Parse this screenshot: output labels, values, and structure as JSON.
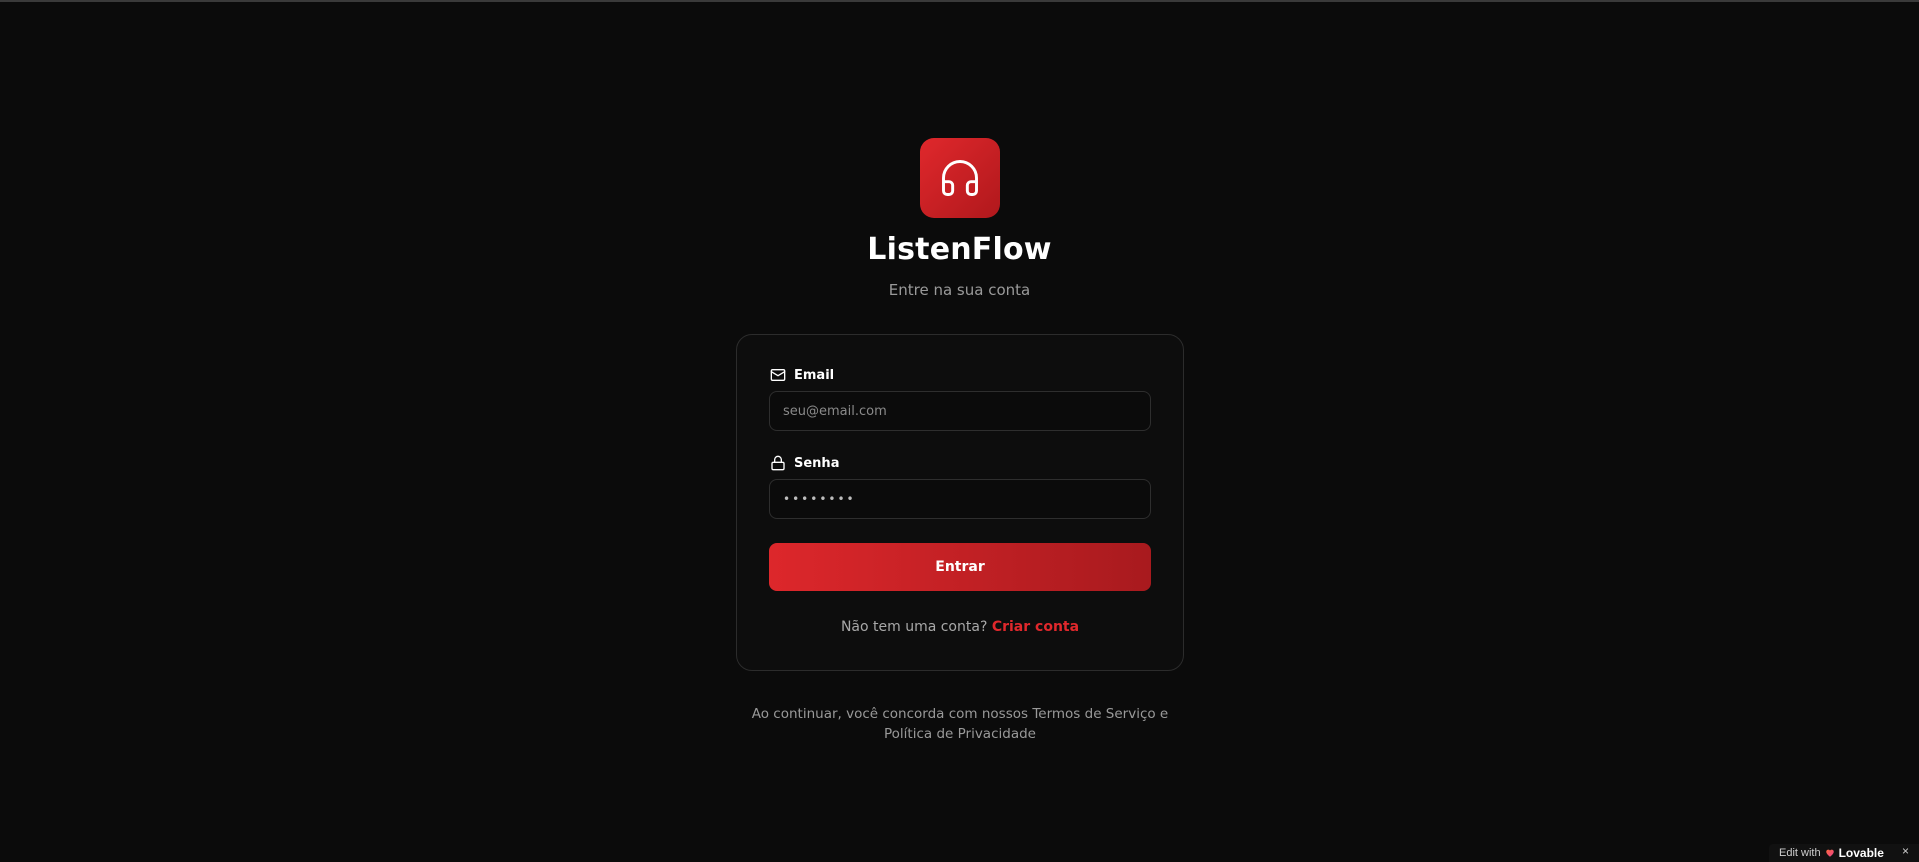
{
  "app": {
    "name": "ListenFlow",
    "subtitle": "Entre na sua conta",
    "logo_icon": "headphones-icon",
    "accent_color": "#dd272b"
  },
  "form": {
    "email": {
      "label": "Email",
      "icon": "mail-icon",
      "placeholder": "seu@email.com",
      "value": ""
    },
    "password": {
      "label": "Senha",
      "icon": "lock-icon",
      "value": "••••••••"
    },
    "submit_label": "Entrar",
    "signup_prompt": "Não tem uma conta?",
    "signup_link": "Criar conta"
  },
  "footer": {
    "terms_text": "Ao continuar, você concorda com nossos Termos de Serviço e Política de Privacidade"
  },
  "badge": {
    "prefix": "Edit with",
    "brand": "Lovable",
    "close": "×"
  }
}
